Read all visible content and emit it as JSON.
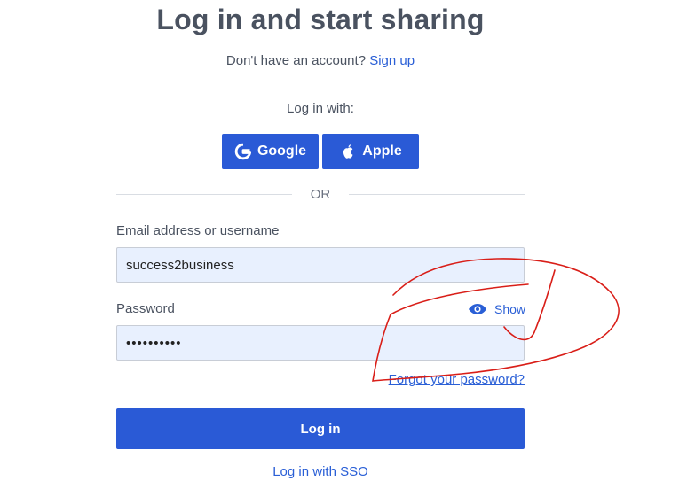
{
  "header": {
    "title": "Log in and start sharing",
    "signup_prompt": "Don't have an account?",
    "signup_link": "Sign up"
  },
  "social": {
    "prompt": "Log in with:",
    "google_label": "Google",
    "apple_label": "Apple",
    "google_icon": "google-g-icon",
    "apple_icon": "apple-icon"
  },
  "divider": {
    "label": "OR"
  },
  "form": {
    "email_label": "Email address or username",
    "email_value": "success2business",
    "password_label": "Password",
    "password_value": "••••••••••",
    "show_label": "Show",
    "show_icon": "eye-icon",
    "forgot_link": "Forgot your password?",
    "login_button": "Log in",
    "sso_link": "Log in with SSO"
  },
  "colors": {
    "primary": "#2a5ad6",
    "link": "#2a5fd6",
    "input_bg": "#e8f0fe",
    "annotation": "#d91e18"
  }
}
